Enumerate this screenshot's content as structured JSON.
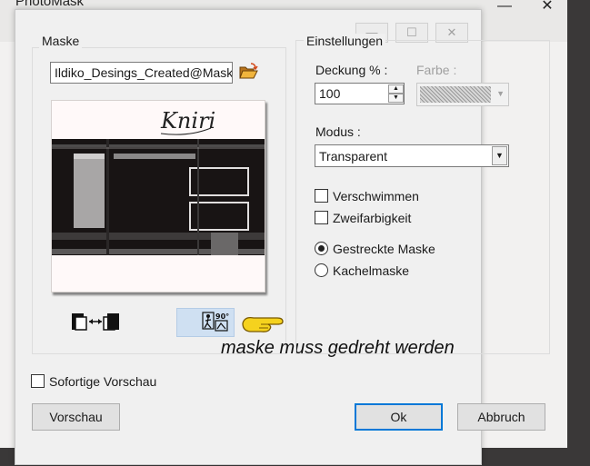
{
  "dialog": {
    "title": "PhotoMask",
    "window_controls": [
      "—",
      "☐",
      "✕"
    ],
    "bg_window_controls": [
      "—",
      "✕"
    ]
  },
  "maske": {
    "group_label": "Maske",
    "file_value": "Ildiko_Desings_Created@Mask",
    "preview_logo_text": "Kniri",
    "rotate_button_label": "90°",
    "annotation": "maske muss gedreht werden"
  },
  "einstellungen": {
    "group_label": "Einstellungen",
    "deckung_label": "Deckung % :",
    "deckung_value": "100",
    "farbe_label": "Farbe :",
    "modus_label": "Modus :",
    "modus_value": "Transparent",
    "verschwimmen_label": "Verschwimmen",
    "zweifarbigkeit_label": "Zweifarbigkeit",
    "gestreckte_label": "Gestreckte Maske",
    "kachel_label": "Kachelmaske"
  },
  "footer": {
    "sofortige_label": "Sofortige Vorschau",
    "vorschau_button": "Vorschau",
    "ok_button": "Ok",
    "abbruch_button": "Abbruch"
  },
  "icons": [
    "folder-open-icon",
    "flip-horizontal-icon",
    "rotate-90-icon",
    "pointing-hand-icon"
  ],
  "colors": {
    "accent": "#0078d7",
    "background_canvas": "#f3d9cc",
    "dark_frame": "#3a3838"
  }
}
